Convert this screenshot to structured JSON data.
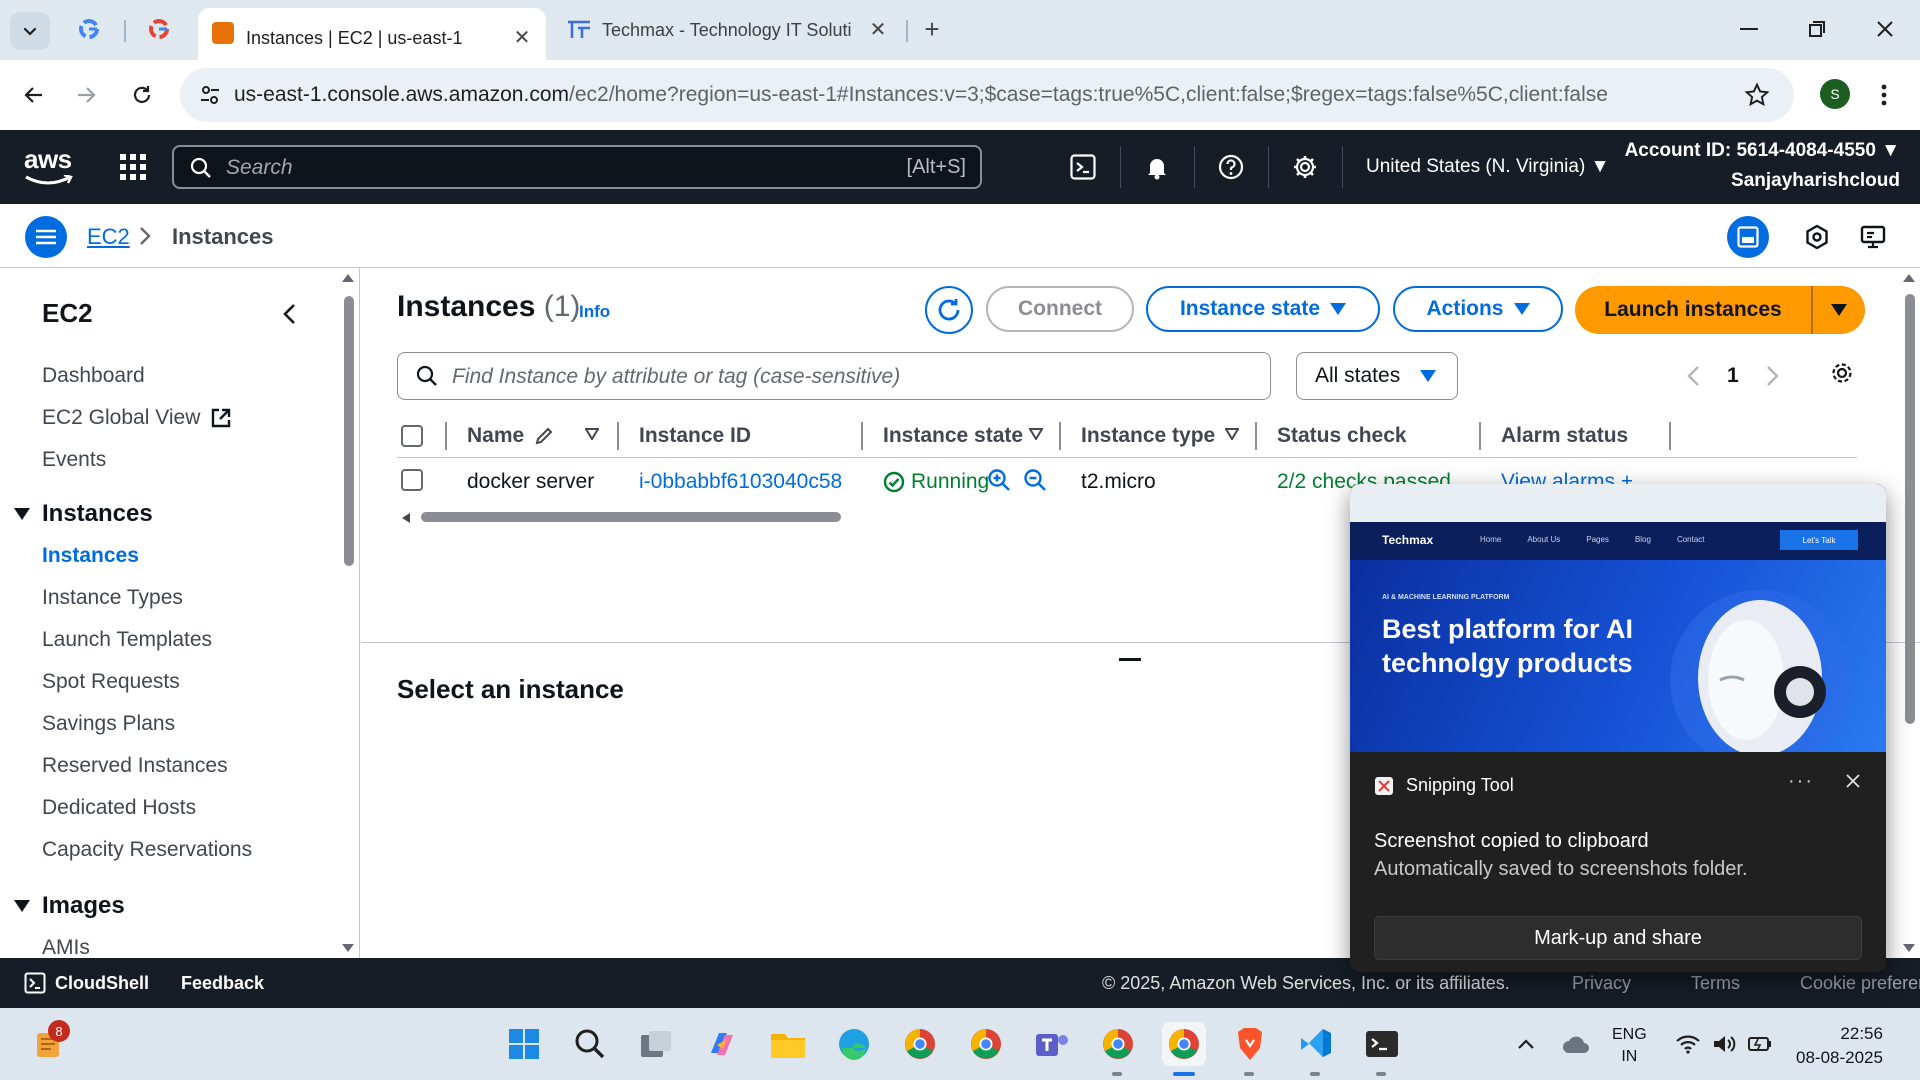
{
  "browser": {
    "tabs": [
      {
        "title": "Instances | EC2 | us-east-1",
        "active": true
      },
      {
        "title": "Techmax - Technology IT Soluti",
        "active": false
      }
    ],
    "url_host": "us-east-1.console.aws.amazon.com",
    "url_path": "/ec2/home?region=us-east-1#Instances:v=3;$case=tags:true%5C,client:false;$regex=tags:false%5C,client:false",
    "profile_initial": "S"
  },
  "aws_header": {
    "logo": "aws",
    "search_placeholder": "Search",
    "search_shortcut": "[Alt+S]",
    "region": "United States (N. Virginia)",
    "account_id": "Account ID: 5614-4084-4550",
    "username": "Sanjayharishcloud"
  },
  "breadcrumb": {
    "root": "EC2",
    "current": "Instances"
  },
  "sidenav": {
    "title": "EC2",
    "top_items": [
      "Dashboard",
      "EC2 Global View",
      "Events"
    ],
    "sections": [
      {
        "label": "Instances",
        "items": [
          "Instances",
          "Instance Types",
          "Launch Templates",
          "Spot Requests",
          "Savings Plans",
          "Reserved Instances",
          "Dedicated Hosts",
          "Capacity Reservations"
        ],
        "active": "Instances"
      },
      {
        "label": "Images",
        "items": [
          "AMIs"
        ]
      }
    ]
  },
  "main": {
    "heading": "Instances",
    "count": "(1)",
    "info": "Info",
    "buttons": {
      "connect": "Connect",
      "instance_state": "Instance state",
      "actions": "Actions",
      "launch": "Launch instances"
    },
    "filter_placeholder": "Find Instance by attribute or tag (case-sensitive)",
    "states_filter": "All states",
    "page": "1",
    "columns": [
      "Name",
      "Instance ID",
      "Instance state",
      "Instance type",
      "Status check",
      "Alarm status"
    ],
    "rows": [
      {
        "name": "docker server",
        "instance_id": "i-0bbabbf6103040c58",
        "state": "Running",
        "type": "t2.micro",
        "status_check": "2/2 checks passed",
        "alarm": "View alarms +"
      }
    ],
    "detail_heading": "Select an instance"
  },
  "aws_footer": {
    "cloudshell": "CloudShell",
    "feedback": "Feedback",
    "copyright": "© 2025, Amazon Web Services, Inc. or its affiliates.",
    "links": [
      "Privacy",
      "Terms",
      "Cookie preferences"
    ]
  },
  "toast": {
    "app": "Snipping Tool",
    "line1": "Screenshot copied to clipboard",
    "line2": "Automatically saved to screenshots folder.",
    "button": "Mark-up and share",
    "preview": {
      "brand": "Techmax",
      "nav": [
        "Home",
        "About Us",
        "Pages",
        "Blog",
        "Contact"
      ],
      "cta": "Let's Talk",
      "eyebrow": "AI & MACHINE LEARNING PLATFORM",
      "headline": "Best platform for AI technolgy products"
    }
  },
  "taskbar": {
    "notification_badge": "8",
    "lang_line1": "ENG",
    "lang_line2": "IN",
    "time": "22:56",
    "date": "08-08-2025"
  },
  "colors": {
    "aws_dark": "#161d26",
    "link_blue": "#006ce0",
    "launch_orange": "#ff9900",
    "running_green": "#00802f"
  }
}
